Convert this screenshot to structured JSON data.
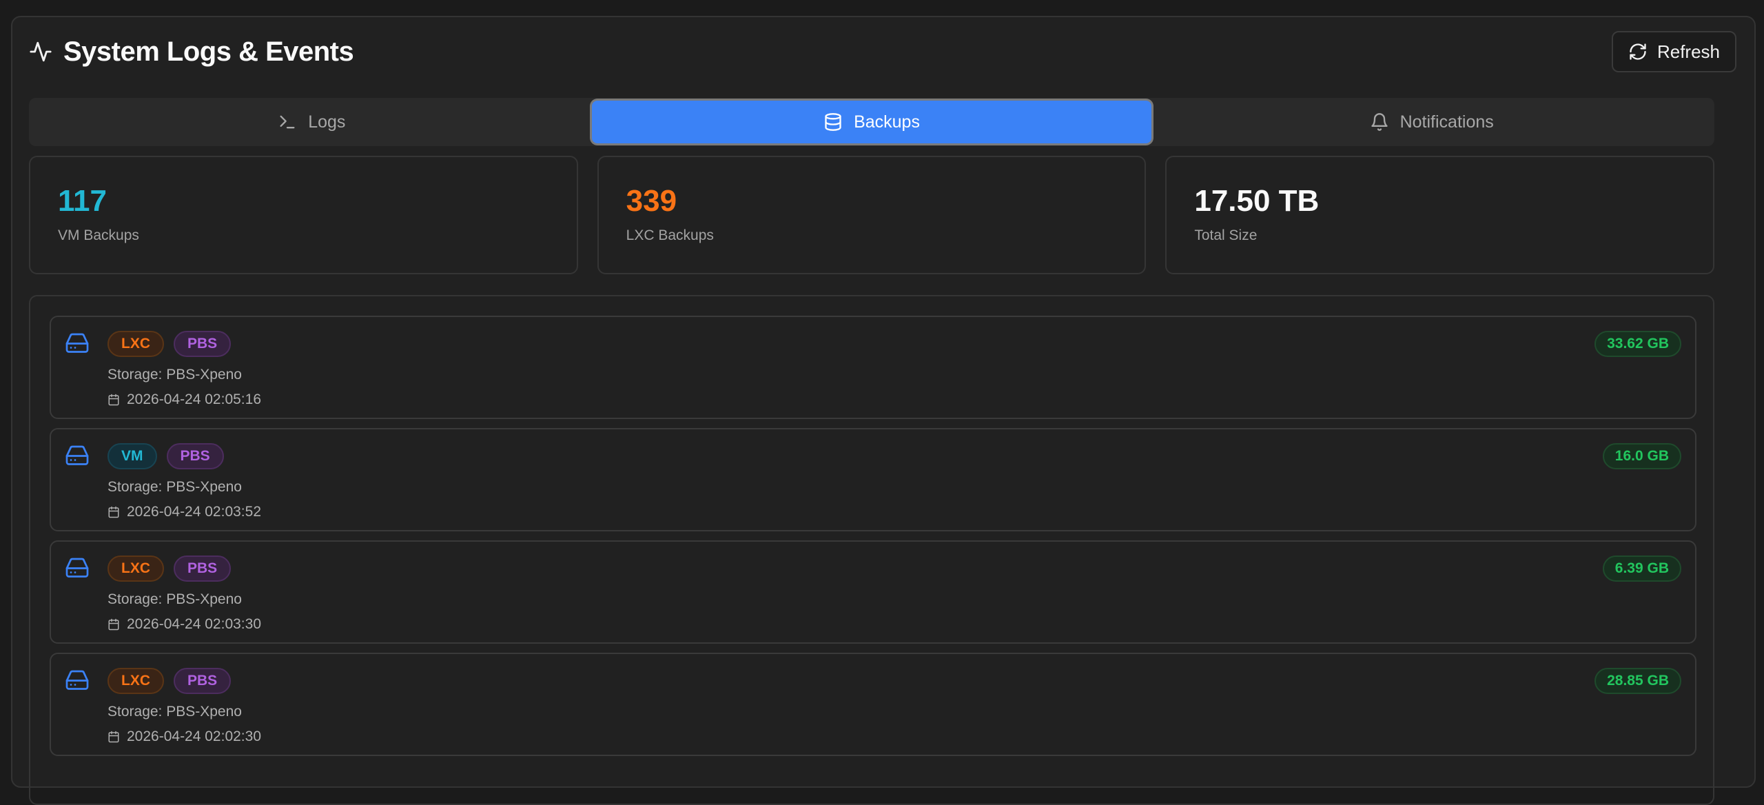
{
  "header": {
    "title": "System Logs & Events",
    "refresh_label": "Refresh"
  },
  "tabs": [
    {
      "label": "Logs",
      "icon": "terminal-icon",
      "active": false
    },
    {
      "label": "Backups",
      "icon": "database-icon",
      "active": true
    },
    {
      "label": "Notifications",
      "icon": "bell-icon",
      "active": false
    }
  ],
  "stats": [
    {
      "value": "117",
      "label": "VM Backups",
      "color": "#22b8d4"
    },
    {
      "value": "339",
      "label": "LXC Backups",
      "color": "#f97316"
    },
    {
      "value": "17.50 TB",
      "label": "Total Size",
      "color": "#fafafa"
    }
  ],
  "backups": [
    {
      "type": "LXC",
      "storage_type": "PBS",
      "storage": "Storage: PBS-Xpeno",
      "date": "2026-04-24 02:05:16",
      "size": "33.62 GB"
    },
    {
      "type": "VM",
      "storage_type": "PBS",
      "storage": "Storage: PBS-Xpeno",
      "date": "2026-04-24 02:03:52",
      "size": "16.0 GB"
    },
    {
      "type": "LXC",
      "storage_type": "PBS",
      "storage": "Storage: PBS-Xpeno",
      "date": "2026-04-24 02:03:30",
      "size": "6.39 GB"
    },
    {
      "type": "LXC",
      "storage_type": "PBS",
      "storage": "Storage: PBS-Xpeno",
      "date": "2026-04-24 02:02:30",
      "size": "28.85 GB"
    }
  ]
}
